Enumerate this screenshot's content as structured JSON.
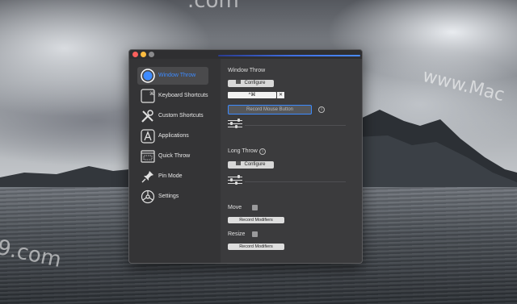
{
  "window": {
    "accent_color": "#3d8bff"
  },
  "sidebar": {
    "items": [
      {
        "label": "Window Throw",
        "icon": "window-throw-icon",
        "selected": true
      },
      {
        "label": "Keyboard Shortcuts",
        "icon": "keyboard-shortcuts-icon"
      },
      {
        "label": "Custom Shortcuts",
        "icon": "tools-icon"
      },
      {
        "label": "Applications",
        "icon": "applications-icon"
      },
      {
        "label": "Quick Throw",
        "icon": "quick-throw-icon"
      },
      {
        "label": "Pin Mode",
        "icon": "pin-icon"
      },
      {
        "label": "Settings",
        "icon": "settings-icon"
      }
    ]
  },
  "content": {
    "window_throw": {
      "title": "Window Throw",
      "configure_label": "Configure",
      "shortcut_value": "^⌘",
      "clear_label": "✕",
      "record_mouse_label": "Record Mouse Button",
      "info_glyph": "i"
    },
    "long_throw": {
      "title": "Long Throw",
      "configure_label": "Configure",
      "info_glyph": "i"
    },
    "move": {
      "label": "Move",
      "record_label": "Record Modifiers"
    },
    "resize": {
      "label": "Resize",
      "record_label": "Record Modifiers"
    }
  },
  "desktop": {
    "watermark_left": "9.com",
    "watermark_top": ".com",
    "watermark_right": "www.Mac"
  }
}
